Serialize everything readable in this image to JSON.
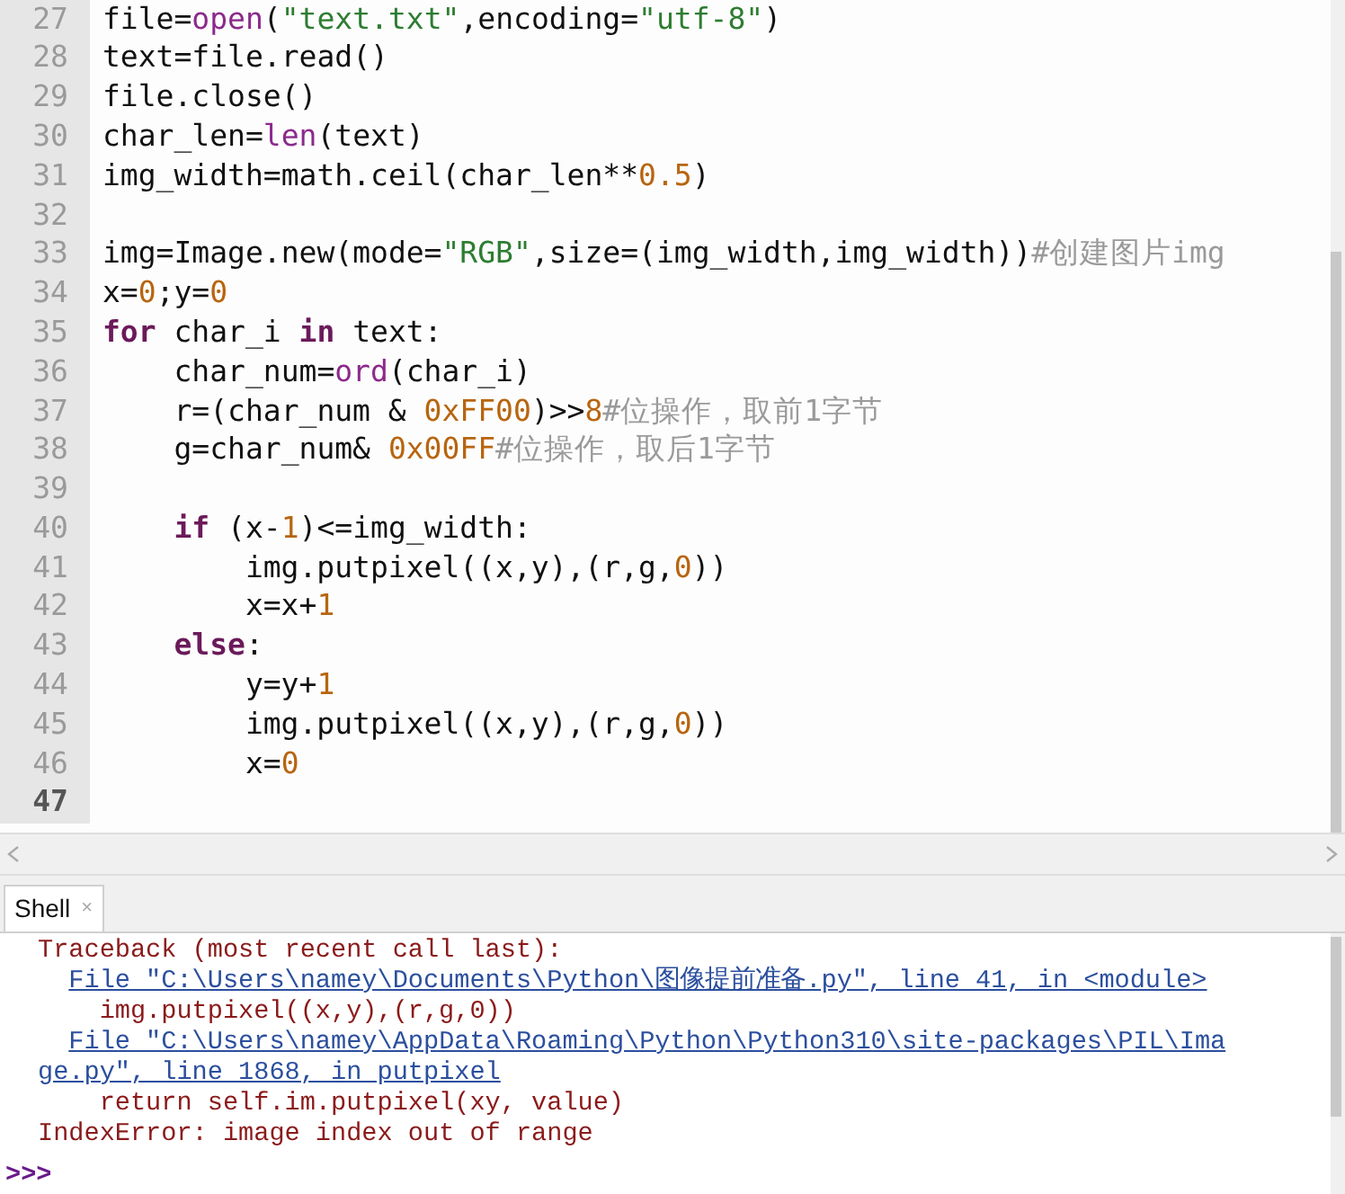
{
  "editor": {
    "lines": [
      {
        "number": "27",
        "current": false,
        "tokens": [
          {
            "kind": "plain",
            "text": "file="
          },
          {
            "kind": "builtin",
            "text": "open"
          },
          {
            "kind": "plain",
            "text": "("
          },
          {
            "kind": "string",
            "text": "\"text.txt\""
          },
          {
            "kind": "plain",
            "text": ",encoding="
          },
          {
            "kind": "string",
            "text": "\"utf-8\""
          },
          {
            "kind": "plain",
            "text": ")"
          }
        ]
      },
      {
        "number": "28",
        "current": false,
        "tokens": [
          {
            "kind": "plain",
            "text": "text=file.read()"
          }
        ]
      },
      {
        "number": "29",
        "current": false,
        "tokens": [
          {
            "kind": "plain",
            "text": "file.close()"
          }
        ]
      },
      {
        "number": "30",
        "current": false,
        "tokens": [
          {
            "kind": "plain",
            "text": "char_len="
          },
          {
            "kind": "builtin",
            "text": "len"
          },
          {
            "kind": "plain",
            "text": "(text)"
          }
        ]
      },
      {
        "number": "31",
        "current": false,
        "tokens": [
          {
            "kind": "plain",
            "text": "img_width=math.ceil(char_len**"
          },
          {
            "kind": "number",
            "text": "0.5"
          },
          {
            "kind": "plain",
            "text": ")"
          }
        ]
      },
      {
        "number": "32",
        "current": false
      },
      {
        "number": "33",
        "current": false,
        "tokens": [
          {
            "kind": "plain",
            "text": "img=Image.new(mode="
          },
          {
            "kind": "string",
            "text": "\"RGB\""
          },
          {
            "kind": "plain",
            "text": ",size=(img_width,img_width))"
          },
          {
            "kind": "comment",
            "text": "#创建图片img"
          }
        ]
      },
      {
        "number": "34",
        "current": false,
        "tokens": [
          {
            "kind": "plain",
            "text": "x="
          },
          {
            "kind": "number",
            "text": "0"
          },
          {
            "kind": "plain",
            "text": ";y="
          },
          {
            "kind": "number",
            "text": "0"
          }
        ]
      },
      {
        "number": "35",
        "current": false,
        "tokens": [
          {
            "kind": "keyword",
            "text": "for"
          },
          {
            "kind": "plain",
            "text": " char_i "
          },
          {
            "kind": "keyword",
            "text": "in"
          },
          {
            "kind": "plain",
            "text": " text:"
          }
        ],
        "children": [
          {
            "number": "36",
            "current": false,
            "tokens": [
              {
                "kind": "plain",
                "text": "char_num="
              },
              {
                "kind": "builtin",
                "text": "ord"
              },
              {
                "kind": "plain",
                "text": "(char_i)"
              }
            ]
          },
          {
            "number": "37",
            "current": false,
            "tokens": [
              {
                "kind": "plain",
                "text": "r=(char_num & "
              },
              {
                "kind": "number",
                "text": "0xFF00"
              },
              {
                "kind": "plain",
                "text": ")>>"
              },
              {
                "kind": "number",
                "text": "8"
              },
              {
                "kind": "comment",
                "text": "#位操作，取前1字节"
              }
            ]
          },
          {
            "number": "38",
            "current": false,
            "tokens": [
              {
                "kind": "plain",
                "text": "g=char_num& "
              },
              {
                "kind": "number",
                "text": "0x00FF"
              },
              {
                "kind": "comment",
                "text": "#位操作，取后1字节"
              }
            ]
          },
          {
            "number": "39",
            "current": false
          },
          {
            "number": "40",
            "current": false,
            "tokens": [
              {
                "kind": "keyword",
                "text": "if"
              },
              {
                "kind": "plain",
                "text": " (x-"
              },
              {
                "kind": "number",
                "text": "1"
              },
              {
                "kind": "plain",
                "text": ")<=img_width:"
              }
            ],
            "children": [
              {
                "number": "41",
                "current": false,
                "tokens": [
                  {
                    "kind": "plain",
                    "text": "img.putpixel((x,y),(r,g,"
                  },
                  {
                    "kind": "number",
                    "text": "0"
                  },
                  {
                    "kind": "plain",
                    "text": "))"
                  }
                ]
              },
              {
                "number": "42",
                "current": false,
                "tokens": [
                  {
                    "kind": "plain",
                    "text": "x=x+"
                  },
                  {
                    "kind": "number",
                    "text": "1"
                  }
                ]
              }
            ]
          },
          {
            "number": "43",
            "current": false,
            "tokens": [
              {
                "kind": "keyword",
                "text": "else"
              },
              {
                "kind": "plain",
                "text": ":"
              }
            ],
            "children": [
              {
                "number": "44",
                "current": false,
                "tokens": [
                  {
                    "kind": "plain",
                    "text": "y=y+"
                  },
                  {
                    "kind": "number",
                    "text": "1"
                  }
                ]
              },
              {
                "number": "45",
                "current": false,
                "tokens": [
                  {
                    "kind": "plain",
                    "text": "img.putpixel((x,y),(r,g,"
                  },
                  {
                    "kind": "number",
                    "text": "0"
                  },
                  {
                    "kind": "plain",
                    "text": "))"
                  }
                ]
              },
              {
                "number": "46",
                "current": false,
                "tokens": [
                  {
                    "kind": "plain",
                    "text": "x="
                  },
                  {
                    "kind": "number",
                    "text": "0"
                  }
                ]
              }
            ]
          }
        ]
      },
      {
        "number": "47",
        "current": true
      }
    ]
  },
  "shell": {
    "tab": {
      "label": "Shell",
      "close": "×",
      "selected": true
    },
    "lines": [
      {
        "kind": "error",
        "text": "Traceback (most recent call last):"
      },
      {
        "kind": "link",
        "text": "File \"C:\\Users\\namey\\Documents\\Python\\图像提前准备.py\", line 41, in <module>"
      },
      {
        "kind": "source",
        "text": "img.putpixel((x,y),(r,g,0))"
      },
      {
        "kind": "link",
        "text": "File \"C:\\Users\\namey\\AppData\\Roaming\\Python\\Python310\\site-packages\\PIL\\Ima"
      },
      {
        "kind": "link-wrap",
        "text": "ge.py\", line 1868, in putpixel"
      },
      {
        "kind": "source",
        "text": "return self.im.putpixel(xy, value)"
      },
      {
        "kind": "error",
        "text": "IndexError: image index out of range"
      }
    ],
    "prompt": ">>>"
  }
}
